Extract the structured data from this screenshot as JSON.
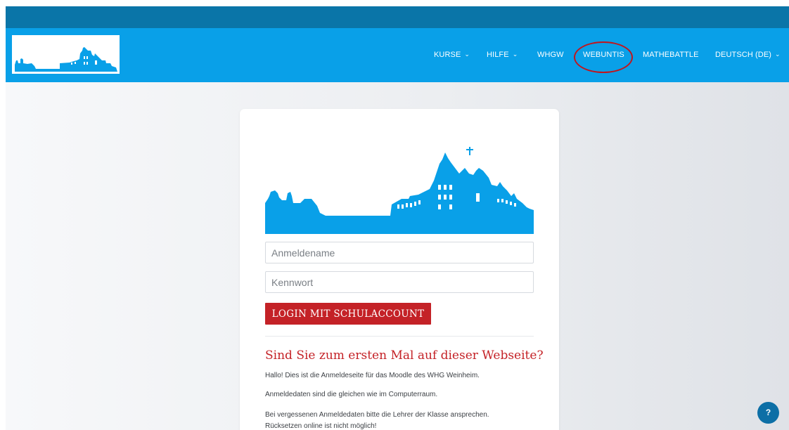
{
  "nav": {
    "kurse": "KURSE",
    "hilfe": "HILFE",
    "whgw": "WHGW",
    "webuntis": "WEBUNTIS",
    "mathebattle": "MATHEBATTLE",
    "language": "DEUTSCH (DE)"
  },
  "login": {
    "username_placeholder": "Anmeldename",
    "password_placeholder": "Kennwort",
    "button_label": "LOGIN MIT SCHULACCOUNT"
  },
  "first_visit": {
    "title": "Sind Sie zum ersten Mal auf dieser Webseite?",
    "line1": "Hallo! Dies ist die Anmeldeseite für das Moodle des WHG Weinheim.",
    "line2": "Anmeldedaten sind die gleichen wie im Computerraum.",
    "line3": "Bei vergessenen Anmeldedaten bitte die Lehrer der Klasse ansprechen.",
    "line4": "Rücksetzen online ist nicht möglich!"
  },
  "help": {
    "label": "?"
  },
  "icons": {
    "chevron": "chevron-down-icon",
    "help": "question-icon"
  },
  "colors": {
    "navbar": "#09a0e8",
    "topstrip": "#0a75a8",
    "accent": "#c42227",
    "annotation": "#c0161e"
  }
}
